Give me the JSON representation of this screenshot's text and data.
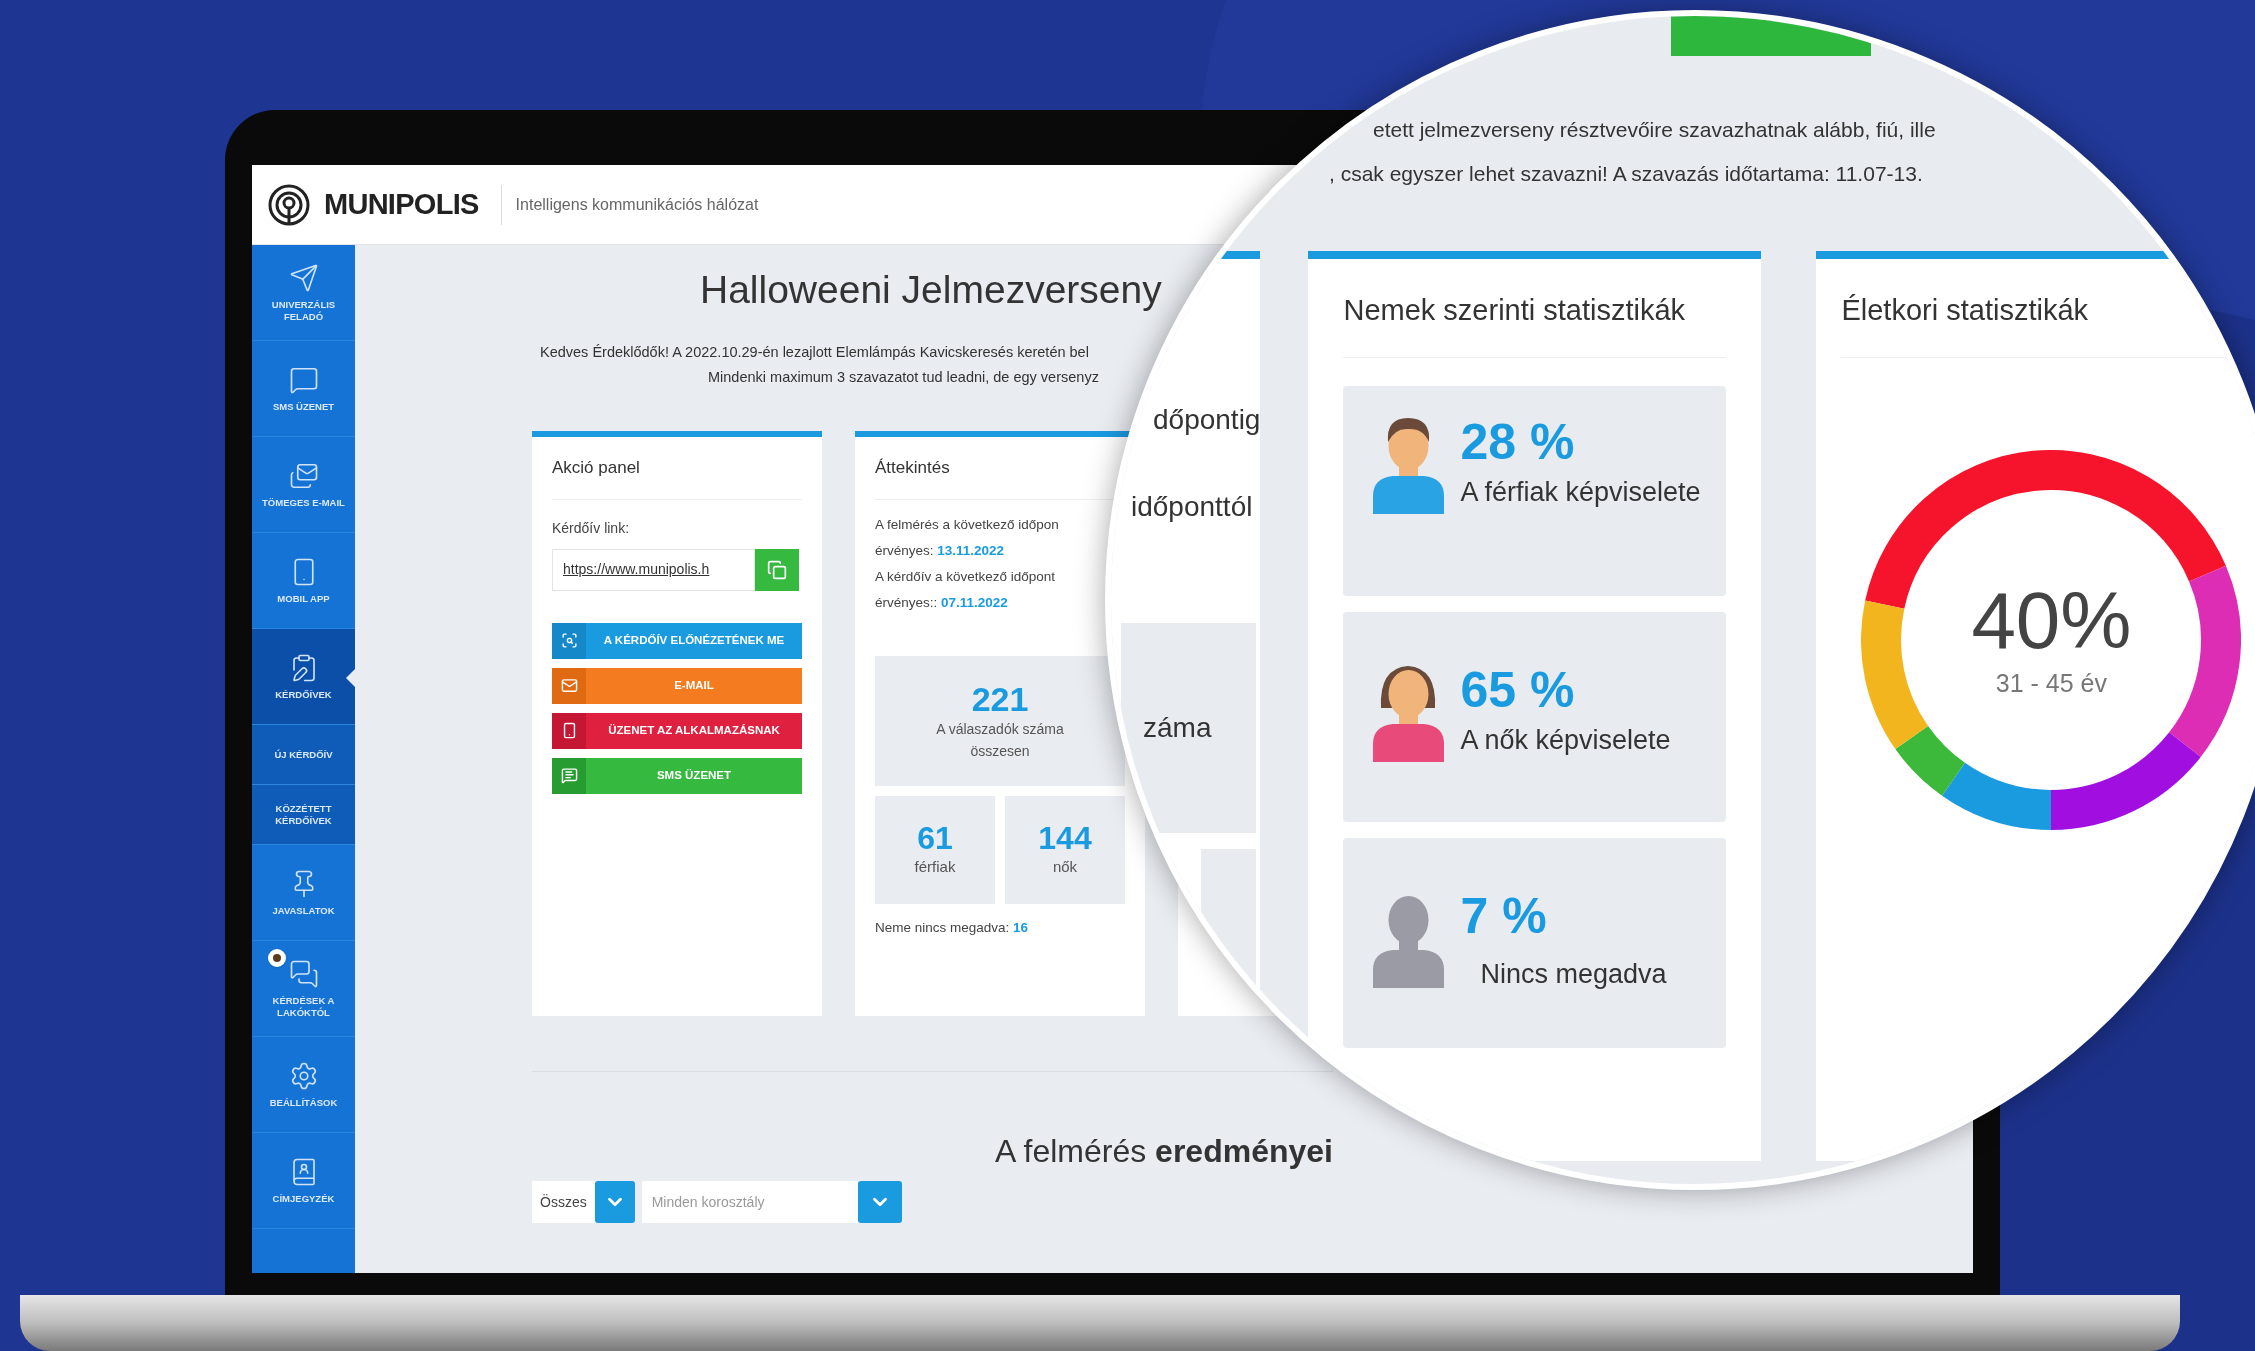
{
  "header": {
    "brand": "MUNIPOLIS",
    "tagline": "Intelligens kommunikációs hálózat"
  },
  "sidebar": {
    "items": [
      {
        "label": "UNIVERZÁLIS FELADÓ",
        "kind": "send",
        "selected": false
      },
      {
        "label": "SMS ÜZENET",
        "kind": "sms",
        "selected": false
      },
      {
        "label": "TÖMEGES E-MAIL",
        "kind": "mail",
        "selected": false
      },
      {
        "label": "MOBIL APP",
        "kind": "phone",
        "selected": false
      },
      {
        "label": "KÉRDŐÍVEK",
        "kind": "survey",
        "selected": true
      },
      {
        "label": "ÚJ KÉRDŐÍV",
        "kind": "sub",
        "selected": false
      },
      {
        "label": "KÖZZÉTETT KÉRDŐÍVEK",
        "kind": "sub",
        "selected": false
      },
      {
        "label": "JAVASLATOK",
        "kind": "pin",
        "selected": false
      },
      {
        "label": "KÉRDÉSEK A LAKÓKTÓL",
        "kind": "chat",
        "selected": false
      },
      {
        "label": "BEÁLLÍTÁSOK",
        "kind": "settings",
        "selected": false
      },
      {
        "label": "CÍMJEGYZÉK",
        "kind": "contacts",
        "selected": false
      }
    ]
  },
  "survey": {
    "title": "Halloweeni Jelmezverseny",
    "intro": [
      "Kedves Érdeklődők! A 2022.10.29-én lezajlott Elemlámpás Kavicskeresés keretén bel",
      "Mindenki maximum 3 szavazatot tud leadni, de egy versenyz"
    ]
  },
  "action_panel": {
    "title": "Akció panel",
    "link_label": "Kérdőív link:",
    "link_value": "https://www.munipolis.h",
    "buttons": [
      {
        "label": "A KÉRDŐÍV ELŐNÉZETÉNEK ME",
        "kind": "preview"
      },
      {
        "label": "E-MAIL",
        "kind": "email"
      },
      {
        "label": "ÜZENET AZ ALKALMAZÁSNAK",
        "kind": "app"
      },
      {
        "label": "SMS ÜZENET",
        "kind": "sms"
      }
    ]
  },
  "overview": {
    "title": "Áttekintés",
    "validity": [
      {
        "text": "A felmérés a következő időpon",
        "label": "érvényes:",
        "date": "13.11.2022"
      },
      {
        "text": "A kérdőív a következő időpont",
        "label": "érvényes::",
        "date": "07.11.2022"
      }
    ],
    "total": {
      "value": "221",
      "label": "A válaszadók száma összesen"
    },
    "men": {
      "value": "61",
      "label": "férfiak"
    },
    "women": {
      "value": "144",
      "label": "nők"
    },
    "unknown": {
      "label": "Neme nincs megadva:",
      "value": "16"
    }
  },
  "results": {
    "heading": "A felmérés **eredményei**",
    "gender_select": {
      "value": "Összes"
    },
    "age_select": {
      "placeholder": "Minden korosztály"
    }
  },
  "magnifier": {
    "intro": [
      "etett jelmezverseny résztvevőire szavazhatnak alább, fiú, ille",
      ", csak egyszer lehet szavazni! A szavazás időtartama: 11.07-13."
    ],
    "fragments": [
      "dőpontig",
      "időponttól",
      "záma"
    ],
    "gender_stats": {
      "title": "Nemek szerinti statisztikák",
      "items": [
        {
          "kind": "male",
          "percent": "28 %",
          "label": "A férfiak képviselete"
        },
        {
          "kind": "female",
          "percent": "65 %",
          "label": "A nők képviselete"
        },
        {
          "kind": "unknown",
          "percent": "7 %",
          "label": "Nincs megadva"
        }
      ]
    },
    "age_stats": {
      "title": "Életkori statisztikák",
      "center_value": "40%",
      "center_label": "31 - 45 év"
    }
  }
}
